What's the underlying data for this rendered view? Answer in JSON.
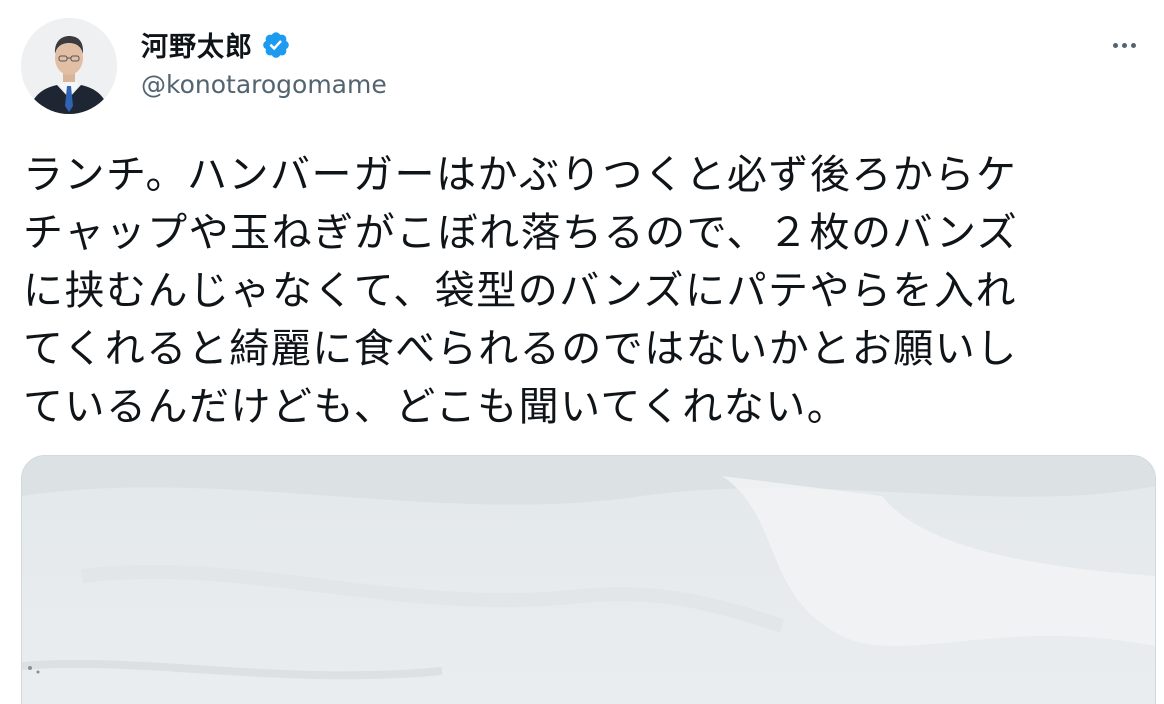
{
  "author": {
    "display_name": "河野太郎",
    "handle": "@konotarogomame",
    "verified": true,
    "avatar_icon": "profile-photo"
  },
  "tweet": {
    "text_lines": [
      "ランチ。ハンバーガーはかぶりつくと必ず後ろからケ",
      "チャップや玉ねぎがこぼれ落ちるので、２枚のバンズ",
      "に挟むんじゃなくて、袋型のバンズにパテやらを入れ",
      "てくれると綺麗に食べられるのではないかとお願いし",
      "ているんだけども、どこも聞いてくれない。"
    ]
  },
  "actions": {
    "more_icon": "more-horizontal-icon"
  },
  "colors": {
    "text_primary": "#0f1419",
    "text_secondary": "#536471",
    "verified_blue": "#1d9bf0",
    "border": "#cfd9de"
  }
}
